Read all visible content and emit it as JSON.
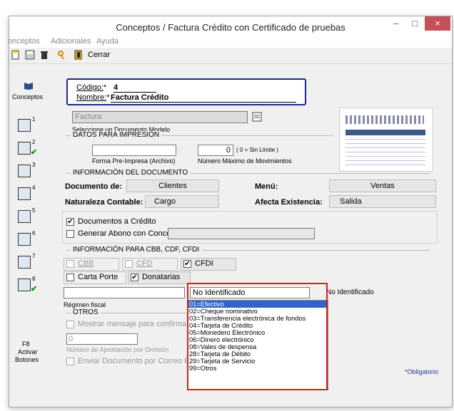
{
  "window": {
    "title": "Conceptos / Factura Crédito con Certificado de pruebas",
    "min_btn": "–",
    "max_btn": "□",
    "close_btn": "×"
  },
  "menu": [
    "onceptos",
    "Adicionales",
    "Ayuda"
  ],
  "toolbar": {
    "close_label": "Cerrar"
  },
  "sidebar": {
    "conceptos_label": "Conceptos",
    "buttons": [
      {
        "num": "1",
        "check": ""
      },
      {
        "num": "2",
        "check": "✔"
      },
      {
        "num": "3",
        "check": ""
      },
      {
        "num": "4",
        "check": ""
      },
      {
        "num": "5",
        "check": ""
      },
      {
        "num": "6",
        "check": ""
      },
      {
        "num": "7",
        "check": ""
      },
      {
        "num": "8",
        "check": "✔"
      }
    ],
    "f8_key": "F8",
    "f8_label1": "Activar",
    "f8_label2": "Botones"
  },
  "header": {
    "codigo_label": "Código:",
    "codigo_value": "4",
    "nombre_label": "Nombre:",
    "nombre_value": "Factura Crédito",
    "required_mark": "*"
  },
  "modelo": {
    "value": "Factura",
    "caption": "Seleccione un Documento Modelo"
  },
  "impresion": {
    "section": "DATOS PARA IMPRESION",
    "forma_label": "Forma Pre-Impresa (Archivo)",
    "movs_value": "0",
    "movs_hint": "( 0 = Sin Límite )",
    "movs_label": "Número Máximo de Movimientos"
  },
  "documento": {
    "section": "INFORMACIÓN  DEL DOCUMENTO",
    "doc_de_label": "Documento de:",
    "doc_de_value": "Clientes",
    "menu_label": "Menú:",
    "menu_value": "Ventas",
    "naturaleza_label": "Naturaleza Contable:",
    "naturaleza_value": "Cargo",
    "afecta_label": "Afecta Existencia:",
    "afecta_value": "Salida",
    "doc_credito_label": "Documentos a Crédito",
    "generar_abono_label": "Generar Abono con Concepto:"
  },
  "cbb": {
    "section": "INFORMACIÓN PARA CBB, CDF, CFDI",
    "cbb_label": "CBB",
    "cfd_label": "CFD",
    "cfdi_label": "CFDI",
    "carta_porte_label": "Carta Porte",
    "donatarias_label": "Donatarias",
    "regimen_label": "Régimen fiscal",
    "metodo_value": "No Identificado",
    "metodo_side_label": "No Identificado"
  },
  "dropdown_options": [
    "01=Efectivo",
    "02=Cheque nominativo",
    "03=Transferencia electrónica de fondos",
    "04=Tarjeta de Crédito",
    "05=Monedero Electrónico",
    "06=Dinero electrónico",
    "08=Vales de despensa",
    "28=Tarjeta de Débito",
    "29=Tarjeta de Servicio",
    "99=Otros"
  ],
  "otros": {
    "section": "OTROS",
    "mostrar_label": "Mostrar mensaje para confirmar no. de",
    "aprob_value": "0",
    "aprob_label": "Número de Aprobación por Omisión",
    "enviar_label": "Enviar Documento por Correo Electrón"
  },
  "footer": {
    "required_note": "*Obligatorio"
  },
  "colors": {
    "accent_border": "#1a2a8a",
    "highlight": "#3064c8",
    "red_box": "#d42020"
  }
}
